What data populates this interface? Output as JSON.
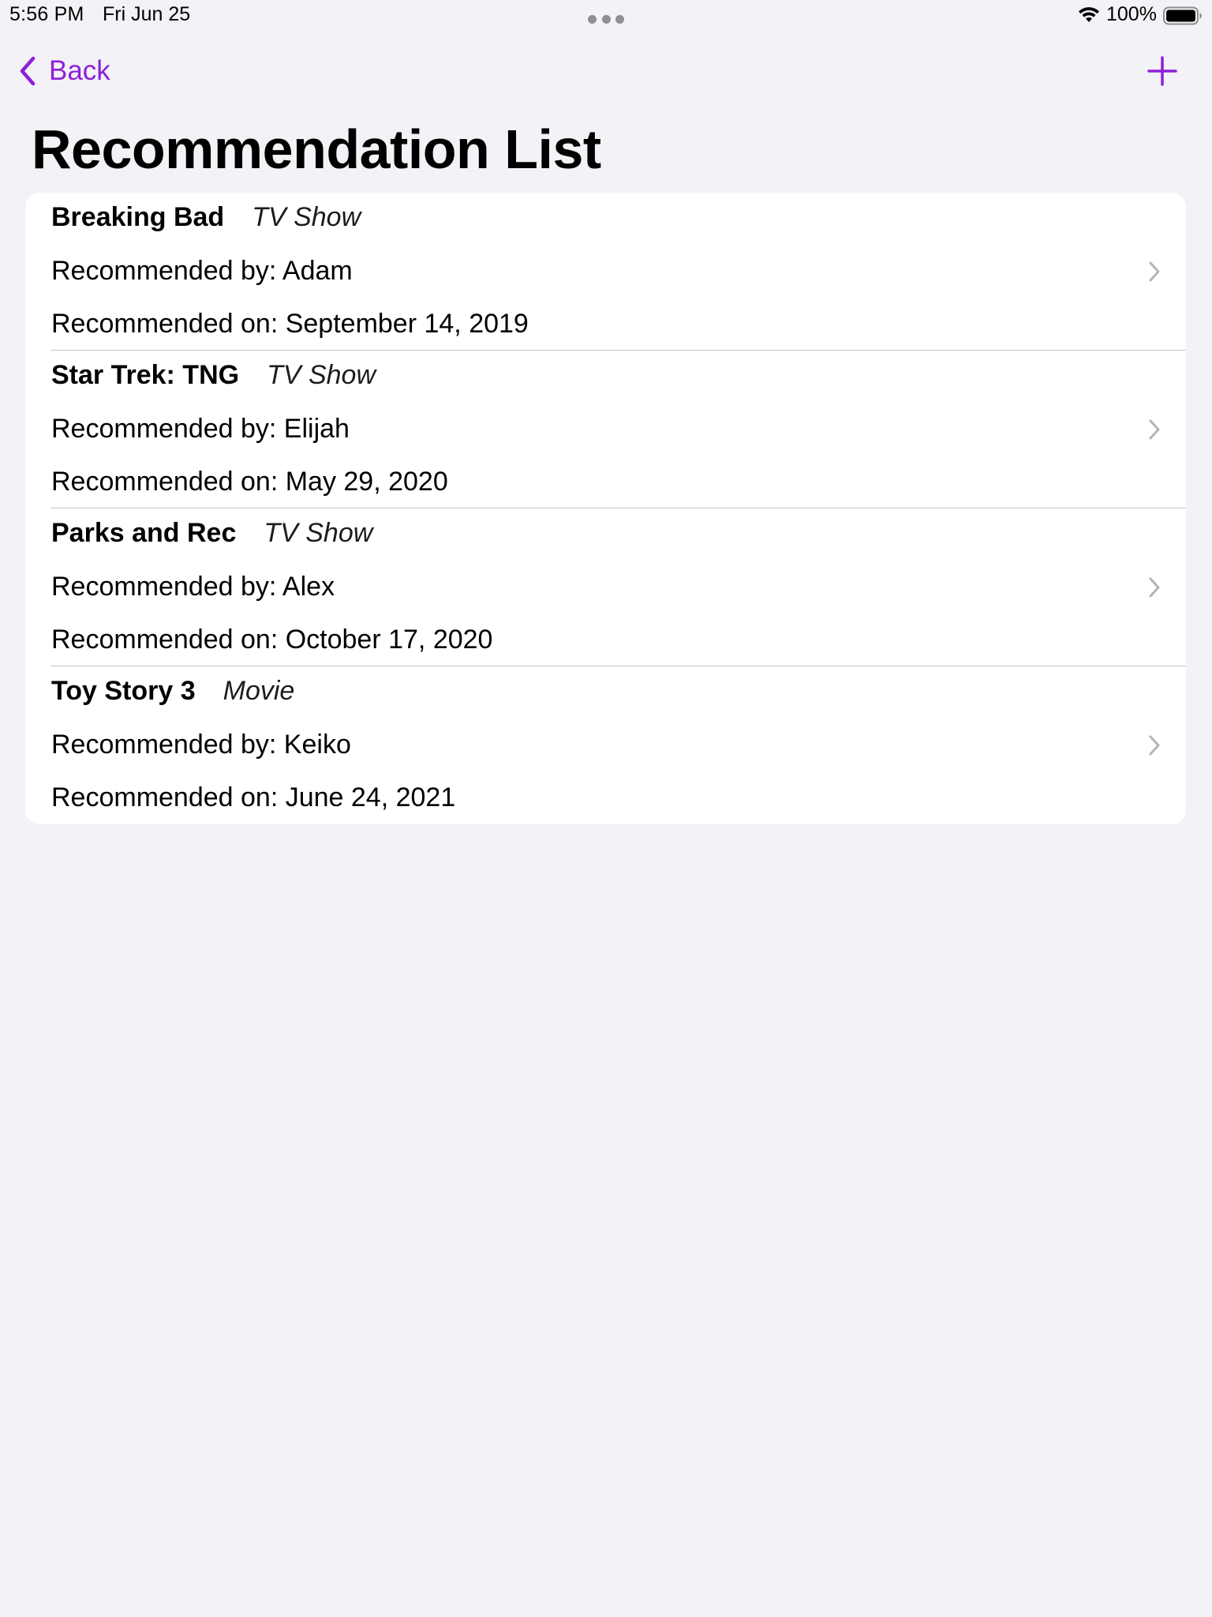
{
  "status_bar": {
    "time": "5:56 PM",
    "date": "Fri Jun 25",
    "battery_percent": "100%",
    "battery_level": 1.0
  },
  "nav": {
    "back_label": "Back",
    "add_icon": "plus-icon",
    "accent_color": "#8f1fd8"
  },
  "page": {
    "title": "Recommendation List"
  },
  "recommendations": [
    {
      "title": "Breaking Bad",
      "type": "TV Show",
      "recommended_by": "Recommended by: Adam",
      "recommended_on": "Recommended on: September 14, 2019"
    },
    {
      "title": "Star Trek: TNG",
      "type": "TV Show",
      "recommended_by": "Recommended by: Elijah",
      "recommended_on": "Recommended on: May 29, 2020"
    },
    {
      "title": "Parks and Rec",
      "type": "TV Show",
      "recommended_by": "Recommended by: Alex",
      "recommended_on": "Recommended on: October 17, 2020"
    },
    {
      "title": "Toy Story 3",
      "type": "Movie",
      "recommended_by": "Recommended by: Keiko",
      "recommended_on": "Recommended on: June 24, 2021"
    }
  ]
}
